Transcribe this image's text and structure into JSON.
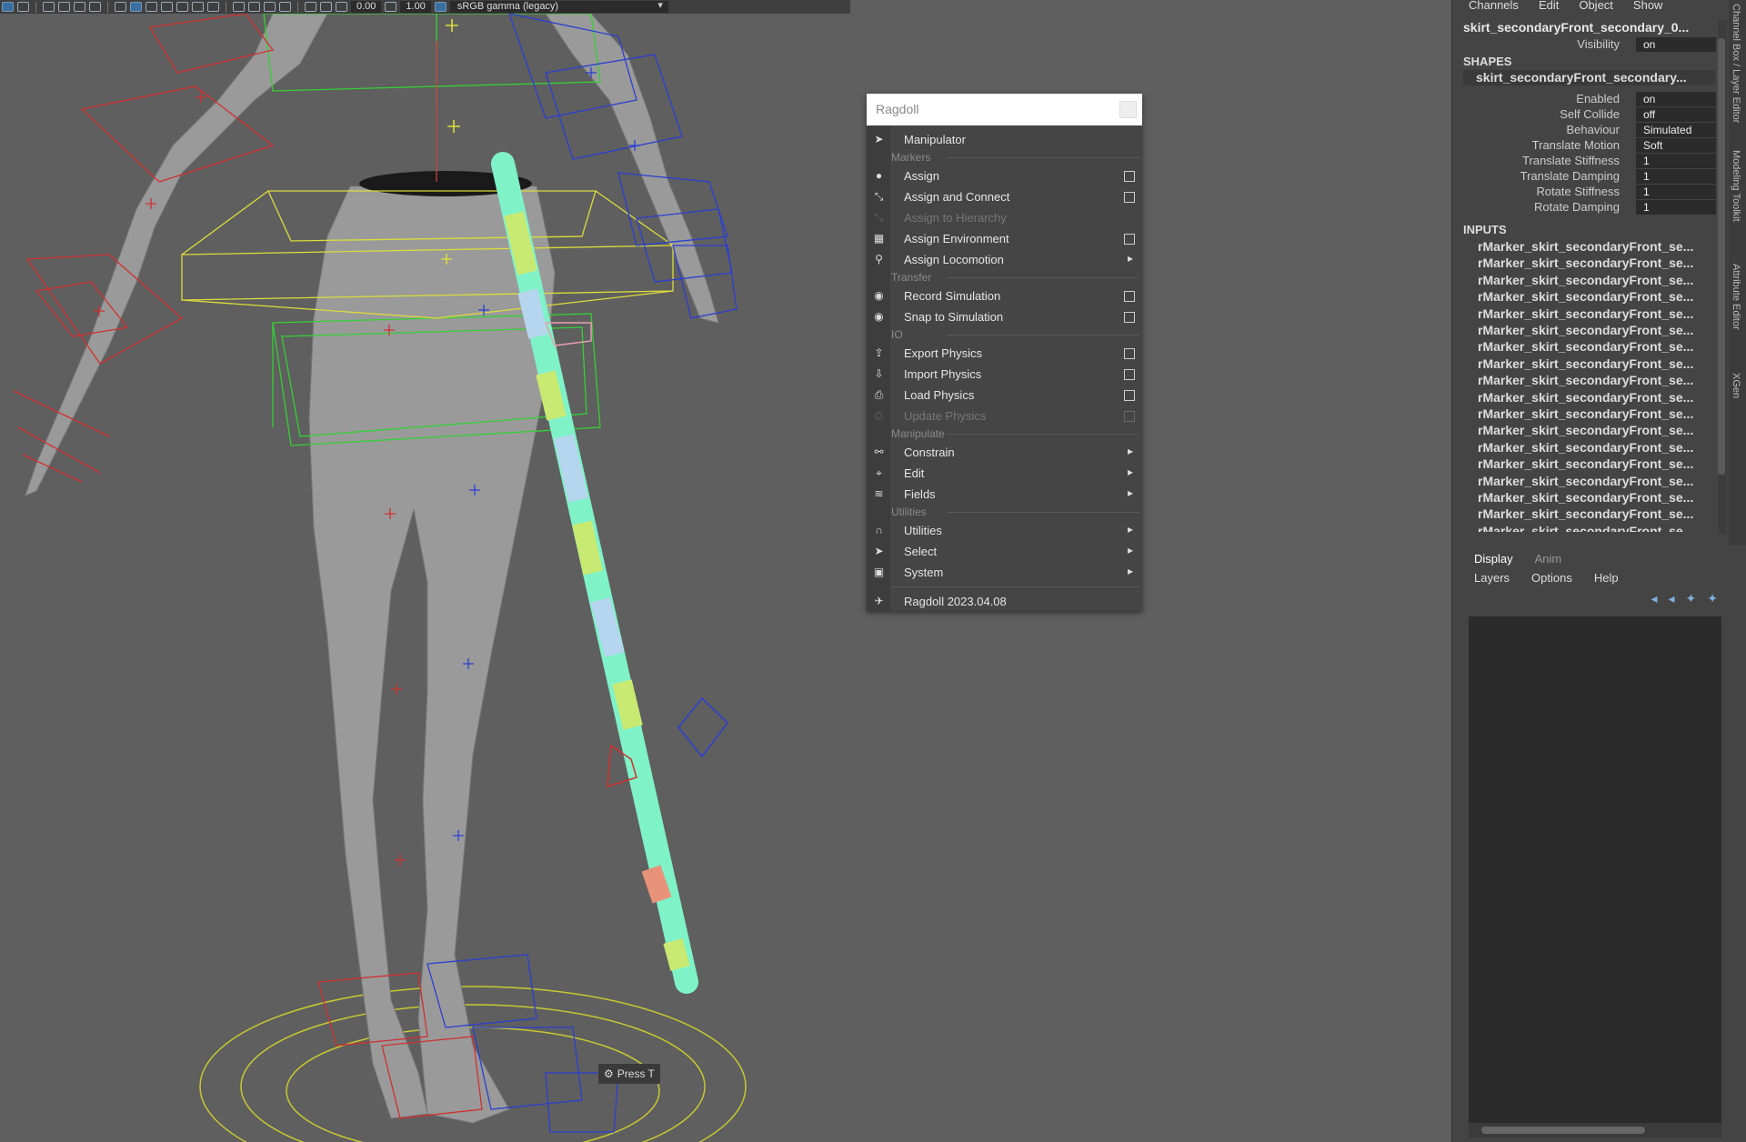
{
  "viewport": {
    "toolbar": {
      "exposure": "0.00",
      "gamma": "1.00",
      "color_space": "sRGB gamma (legacy)"
    },
    "hotkey_hint": "Press T"
  },
  "ragdoll_menu": {
    "title": "Ragdoll",
    "items": [
      {
        "type": "item",
        "icon": "cursor-icon",
        "label": "Manipulator"
      },
      {
        "type": "section",
        "label": "Markers"
      },
      {
        "type": "item",
        "icon": "dot-icon",
        "label": "Assign",
        "option_box": true
      },
      {
        "type": "item",
        "icon": "connect-icon",
        "label": "Assign and Connect",
        "option_box": true
      },
      {
        "type": "item",
        "icon": "hierarchy-icon",
        "label": "Assign to Hierarchy",
        "disabled": true
      },
      {
        "type": "item",
        "icon": "grid-icon",
        "label": "Assign Environment",
        "option_box": true
      },
      {
        "type": "item",
        "icon": "footprint-icon",
        "label": "Assign Locomotion",
        "submenu": true
      },
      {
        "type": "section",
        "label": "Transfer"
      },
      {
        "type": "item",
        "icon": "record-icon",
        "label": "Record Simulation",
        "option_box": true
      },
      {
        "type": "item",
        "icon": "snap-icon",
        "label": "Snap to Simulation",
        "option_box": true
      },
      {
        "type": "section",
        "label": "IO"
      },
      {
        "type": "item",
        "icon": "export-icon",
        "label": "Export Physics",
        "option_box": true
      },
      {
        "type": "item",
        "icon": "import-icon",
        "label": "Import Physics",
        "option_box": true
      },
      {
        "type": "item",
        "icon": "load-icon",
        "label": "Load Physics",
        "option_box": true
      },
      {
        "type": "item",
        "icon": "update-icon",
        "label": "Update Physics",
        "option_box": true,
        "disabled": true
      },
      {
        "type": "section",
        "label": "Manipulate"
      },
      {
        "type": "item",
        "icon": "link-icon",
        "label": "Constrain",
        "submenu": true
      },
      {
        "type": "item",
        "icon": "edit-icon",
        "label": "Edit",
        "submenu": true
      },
      {
        "type": "item",
        "icon": "fields-icon",
        "label": "Fields",
        "submenu": true
      },
      {
        "type": "section",
        "label": "Utilities"
      },
      {
        "type": "item",
        "icon": "magnet-icon",
        "label": "Utilities",
        "submenu": true
      },
      {
        "type": "item",
        "icon": "select-icon",
        "label": "Select",
        "submenu": true
      },
      {
        "type": "item",
        "icon": "system-icon",
        "label": "System",
        "submenu": true
      },
      {
        "type": "divider"
      },
      {
        "type": "item",
        "icon": "ragdoll-logo-icon",
        "label": "Ragdoll 2023.04.08"
      }
    ]
  },
  "channel_box": {
    "menu": [
      "Channels",
      "Edit",
      "Object",
      "Show"
    ],
    "node_name": "skirt_secondaryFront_secondary_0...",
    "visibility": {
      "label": "Visibility",
      "value": "on"
    },
    "shapes_header": "SHAPES",
    "shape_name": "skirt_secondaryFront_secondary...",
    "attributes": [
      {
        "label": "Enabled",
        "value": "on"
      },
      {
        "label": "Self Collide",
        "value": "off"
      },
      {
        "label": "Behaviour",
        "value": "Simulated"
      },
      {
        "label": "Translate Motion",
        "value": "Soft"
      },
      {
        "label": "Translate Stiffness",
        "value": "1"
      },
      {
        "label": "Translate Damping",
        "value": "1"
      },
      {
        "label": "Rotate Stiffness",
        "value": "1"
      },
      {
        "label": "Rotate Damping",
        "value": "1"
      }
    ],
    "inputs_header": "INPUTS",
    "inputs": [
      "rMarker_skirt_secondaryFront_se...",
      "rMarker_skirt_secondaryFront_se...",
      "rMarker_skirt_secondaryFront_se...",
      "rMarker_skirt_secondaryFront_se...",
      "rMarker_skirt_secondaryFront_se...",
      "rMarker_skirt_secondaryFront_se...",
      "rMarker_skirt_secondaryFront_se...",
      "rMarker_skirt_secondaryFront_se...",
      "rMarker_skirt_secondaryFront_se...",
      "rMarker_skirt_secondaryFront_se...",
      "rMarker_skirt_secondaryFront_se...",
      "rMarker_skirt_secondaryFront_se...",
      "rMarker_skirt_secondaryFront_se...",
      "rMarker_skirt_secondaryFront_se...",
      "rMarker_skirt_secondaryFront_se...",
      "rMarker_skirt_secondaryFront_se...",
      "rMarker_skirt_secondaryFront_se...",
      "rMarker_skirt_secondaryFront_se..."
    ]
  },
  "side_tabs": [
    "Channel Box / Layer Editor",
    "Modeling Toolkit",
    "Attribute Editor",
    "XGen"
  ],
  "layer_editor": {
    "tabs": [
      "Display",
      "Anim"
    ],
    "menu": [
      "Layers",
      "Options",
      "Help"
    ]
  }
}
